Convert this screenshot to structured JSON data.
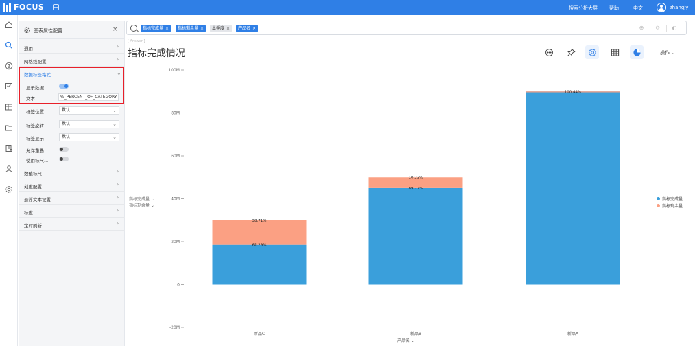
{
  "app": {
    "logo_text": "FOCUS",
    "top_links": [
      "搜索分析大屏",
      "帮助",
      "中文"
    ],
    "username": "zhangjy"
  },
  "panel": {
    "title": "图表属性配置",
    "sections_top": [
      "通用",
      "网格线配置"
    ],
    "open_section": "数据标签格式",
    "show_data_label": {
      "label": "显示数据...",
      "on": true
    },
    "text_row": {
      "label": "文本",
      "value": "%_PERCENT_OF_CATEGORY"
    },
    "selects": [
      {
        "label": "标签位置",
        "value": "默认"
      },
      {
        "label": "标签旋转",
        "value": "默认"
      },
      {
        "label": "标签显示",
        "value": "默认"
      }
    ],
    "toggles": [
      {
        "label": "允许重叠",
        "on": false
      },
      {
        "label": "使用标尺...",
        "on": false
      }
    ],
    "sections_bottom": [
      "数值标尺",
      "刻度配置",
      "悬浮文本设置",
      "标度",
      "定时刷新"
    ]
  },
  "search": {
    "chips": [
      {
        "text": "指标完成量",
        "style": "blue"
      },
      {
        "text": "指标剩余量",
        "style": "blue"
      },
      {
        "text": "本季度",
        "style": "gray"
      },
      {
        "text": "产品名",
        "style": "blue"
      }
    ]
  },
  "chart_header": {
    "crumb": "[ Answer ]",
    "title": "指标完成情况",
    "operations": "操作"
  },
  "chart_data": {
    "type": "bar",
    "stacked": true,
    "categories": [
      "新品C",
      "新品B",
      "新品A"
    ],
    "series": [
      {
        "name": "指标完成量",
        "color": "#3a9fdb",
        "values": [
          18.5,
          45,
          90
        ],
        "labels": [
          "61.29%",
          "89.77%",
          "100.44%"
        ]
      },
      {
        "name": "指标剩余量",
        "color": "#fba083",
        "values": [
          11.5,
          5,
          -0.4
        ],
        "labels": [
          "38.71%",
          "10.23%",
          ""
        ]
      }
    ],
    "yticks": [
      "-20M",
      "0",
      "20M",
      "40M",
      "60M",
      "80M",
      "100M"
    ],
    "ylim": [
      -20,
      100
    ],
    "y_unit": "M",
    "ylabel_measures": [
      "指标完成量",
      "指标剩余量"
    ],
    "xlabel": "产品名",
    "legend_position": "right"
  }
}
